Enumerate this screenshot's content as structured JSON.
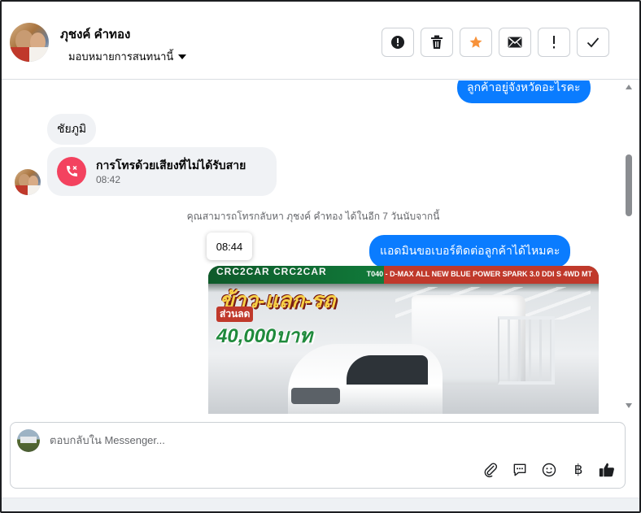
{
  "header": {
    "contact_name": "ภุชงค์ คำทอง",
    "assign_label": "มอบหมายการสนทนานี้",
    "actions": [
      {
        "icon": "alert-circle-icon",
        "label": "spam"
      },
      {
        "icon": "trash-icon",
        "label": "delete"
      },
      {
        "icon": "star-icon",
        "label": "star"
      },
      {
        "icon": "envelope-icon",
        "label": "mark-unread"
      },
      {
        "icon": "exclamation-icon",
        "label": "follow-up"
      },
      {
        "icon": "check-icon",
        "label": "done"
      }
    ],
    "star_color": "#f7923a"
  },
  "messages": {
    "outgoing_top": "ลูกค้าอยู่จังหวัดอะไรคะ",
    "incoming_name": "ชัยภูมิ",
    "missed_call": {
      "title": "การโทรด้วยเสียงที่ไม่ได้รับสาย",
      "time": "08:42"
    },
    "system_note": "คุณสามารถโทรกลับหา ภุชงค์ คำทอง ได้ในอีก 7 วันนับจากนี้",
    "tooltip_time": "08:44",
    "outgoing_question": "แอดมินขอเบอร์ติดต่อลูกค้าได้ไหมคะ",
    "image": {
      "brand_text": "CRC2CAR CRC2CAR",
      "model_text": "T040 - D-MAX ALL NEW BLUE POWER SPARK 3.0 DDI S 4WD MT",
      "promo_line1": "ข้าว-แลก-รถ",
      "promo_line2": "ส่วนลด",
      "promo_amount": "40,000บาท"
    }
  },
  "composer": {
    "placeholder": "ตอบกลับใน Messenger...",
    "icons": [
      "paperclip-icon",
      "saved-reply-icon",
      "emoji-icon",
      "baht-icon",
      "thumbs-up-icon"
    ],
    "baht_symbol": "฿"
  },
  "colors": {
    "outgoing_bubble": "#0a7cff",
    "incoming_bubble": "#f0f2f5",
    "missed_call": "#f3425f"
  }
}
